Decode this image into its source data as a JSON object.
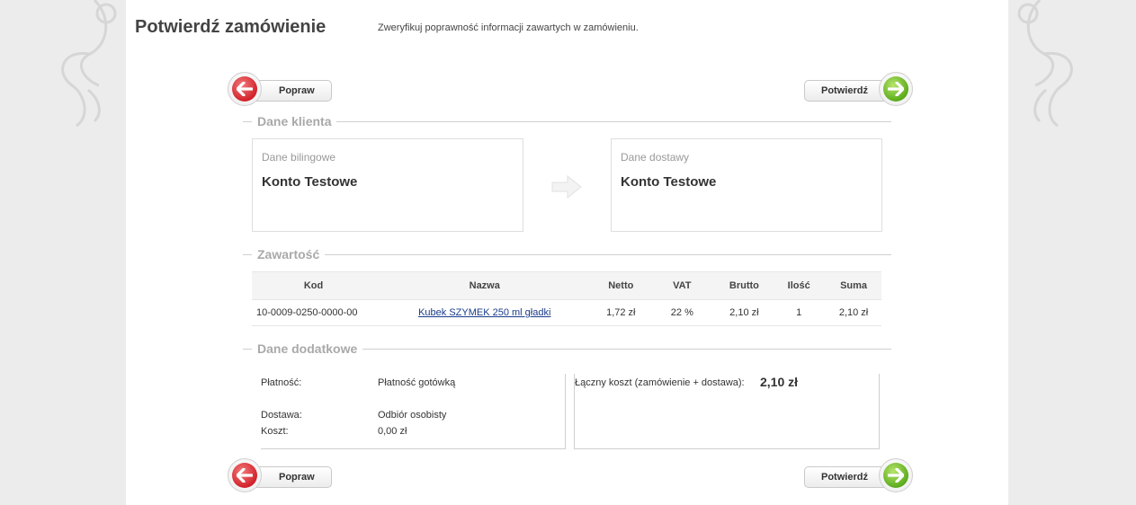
{
  "header": {
    "title": "Potwierdź zamówienie",
    "subtitle": "Zweryfikuj poprawność informacji zawartych w zamówieniu."
  },
  "buttons": {
    "back_label": "Popraw",
    "confirm_label": "Potwierdź"
  },
  "customer": {
    "section_title": "Dane klienta",
    "billing": {
      "heading": "Dane bilingowe",
      "name": "Konto Testowe"
    },
    "shipping": {
      "heading": "Dane dostawy",
      "name": "Konto Testowe"
    }
  },
  "contents": {
    "section_title": "Zawartość",
    "columns": [
      "Kod",
      "Nazwa",
      "Netto",
      "VAT",
      "Brutto",
      "Ilość",
      "Suma"
    ],
    "rows": [
      {
        "code": "10-0009-0250-0000-00",
        "name": "Kubek SZYMEK 250 ml gładki",
        "net": "1,72 zł",
        "vat": "22 %",
        "gross": "2,10 zł",
        "qty": "1",
        "sum": "2,10 zł"
      }
    ]
  },
  "additional": {
    "section_title": "Dane dodatkowe",
    "payment_label": "Płatność:",
    "payment_value": "Płatność gotówką",
    "delivery_label": "Dostawa:",
    "delivery_value": "Odbiór osobisty",
    "cost_label": "Koszt:",
    "cost_value": "0,00 zł",
    "total_label": "Łączny koszt (zamówienie + dostawa):",
    "total_value": "2,10 zł"
  },
  "colors": {
    "back_icon": "#d2222b",
    "confirm_icon": "#5cac1d",
    "link": "#1a3c8c"
  },
  "icons": {
    "back": "arrow-left-icon",
    "confirm": "arrow-right-icon",
    "transfer": "arrow-right-icon"
  }
}
